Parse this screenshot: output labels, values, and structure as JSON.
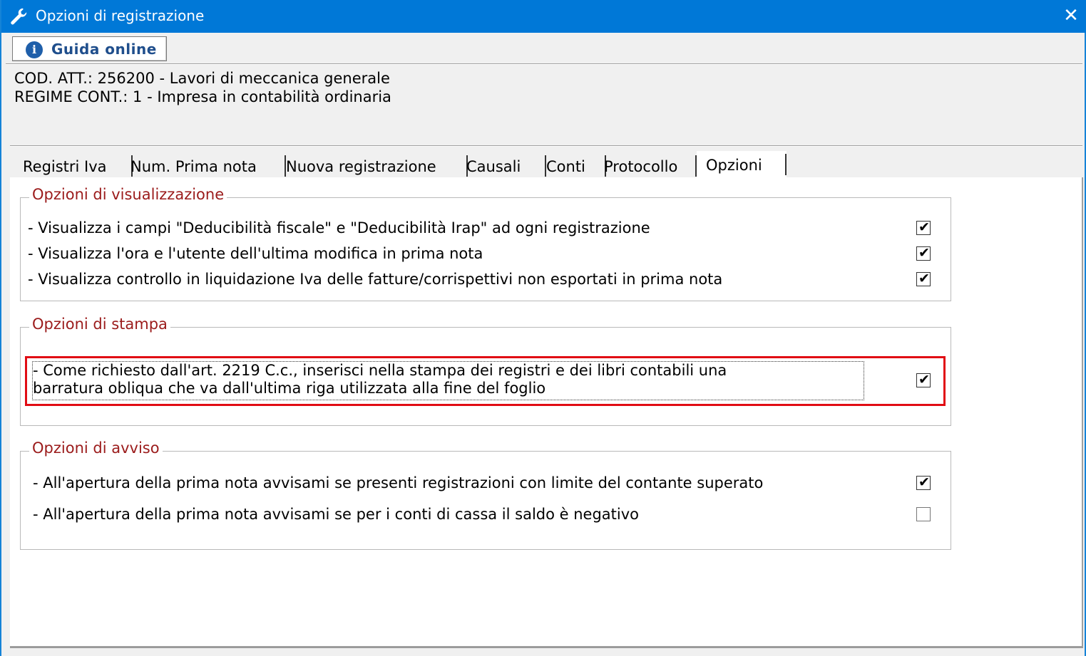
{
  "window": {
    "title": "Opzioni di registrazione",
    "close_glyph": "✕"
  },
  "help_button": {
    "label": "Guida online",
    "icon": "i"
  },
  "info": {
    "line1": "COD. ATT.: 256200 - Lavori di meccanica generale",
    "line2": "REGIME CONT.: 1 - Impresa  in contabilità ordinaria"
  },
  "tabs": [
    {
      "label": "Registri Iva"
    },
    {
      "label": "Num. Prima nota"
    },
    {
      "label": "Nuova registrazione"
    },
    {
      "label": "Causali"
    },
    {
      "label": "Conti"
    },
    {
      "label": "Protocollo"
    },
    {
      "label": "Opzioni",
      "active": true
    }
  ],
  "groups": {
    "visualizzazione": {
      "title": "Opzioni di visualizzazione",
      "options": [
        {
          "label": "- Visualizza i campi \"Deducibilità fiscale\" e \"Deducibilità Irap\" ad ogni registrazione",
          "checked": true
        },
        {
          "label": "- Visualizza l'ora e l'utente dell'ultima modifica in prima nota",
          "checked": true
        },
        {
          "label": "- Visualizza controllo in liquidazione Iva delle fatture/corrispettivi non esportati in prima nota",
          "checked": true
        }
      ]
    },
    "stampa": {
      "title": "Opzioni di stampa",
      "option": {
        "line1": "- Come richiesto dall'art. 2219 C.c., inserisci nella stampa dei registri e dei libri contabili una",
        "line2": "barratura obliqua che va dall'ultima riga utilizzata alla fine del foglio",
        "checked": true
      }
    },
    "avviso": {
      "title": "Opzioni di avviso",
      "options": [
        {
          "label": "- All'apertura della prima nota avvisami se presenti registrazioni con limite del contante superato",
          "checked": true
        },
        {
          "label": "- All'apertura della prima nota avvisami se per i conti di cassa il saldo è negativo",
          "checked": false
        }
      ]
    }
  },
  "checkmark_glyph": "✔",
  "colors": {
    "titlebar": "#0078d7",
    "legend": "#9b1b1b",
    "highlight": "#e10c14"
  }
}
